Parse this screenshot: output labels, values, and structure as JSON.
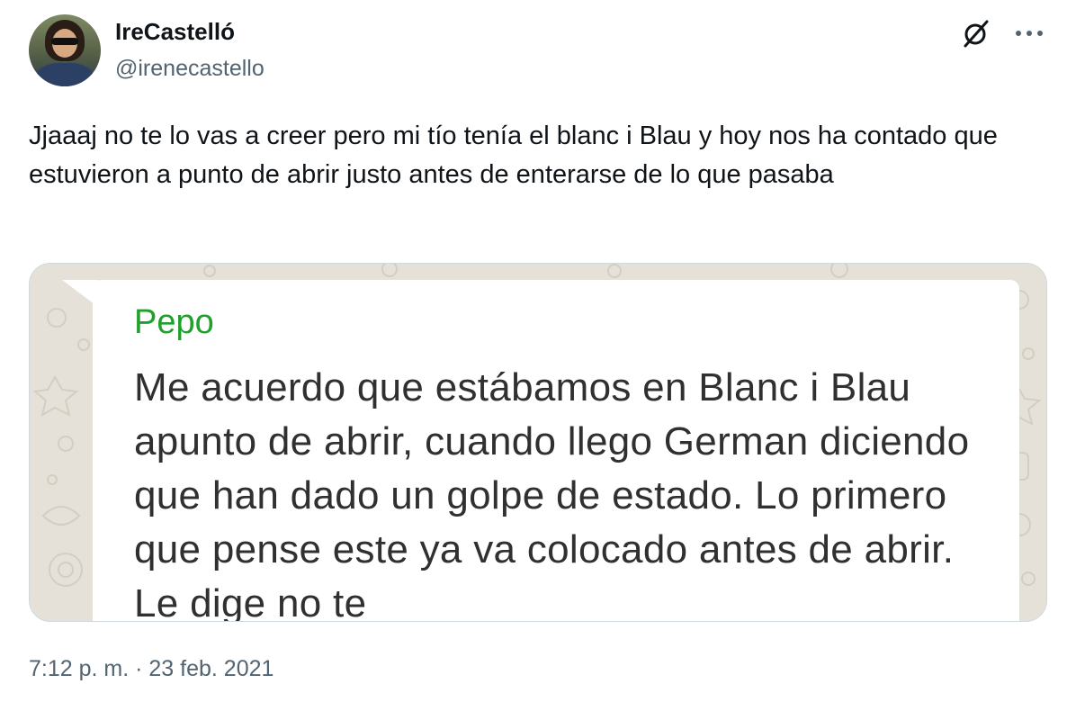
{
  "author": {
    "display_name": "IreCastelló",
    "handle": "@irenecastello",
    "avatar_icon": "profile-photo"
  },
  "header_icons": {
    "grok": "grok-icon",
    "more": "more-options-icon"
  },
  "tweet": {
    "text": "Jjaaaj no te lo vas a creer pero mi tío tenía el blanc i Blau y hoy nos ha contado que estuvieron a punto de abrir justo antes de enterarse de lo que pasaba",
    "timestamp": "7:12 p. m. · 23 feb. 2021"
  },
  "media": {
    "sender": "Pepo",
    "message": "Me acuerdo que estábamos en Blanc i Blau apunto de abrir, cuando llego German diciendo que han dado un golpe de estado. Lo primero que pense este ya va colocado antes de abrir. Le dige no te",
    "sender_color": "#1fa02a",
    "background_color": "#e6e1d8"
  }
}
